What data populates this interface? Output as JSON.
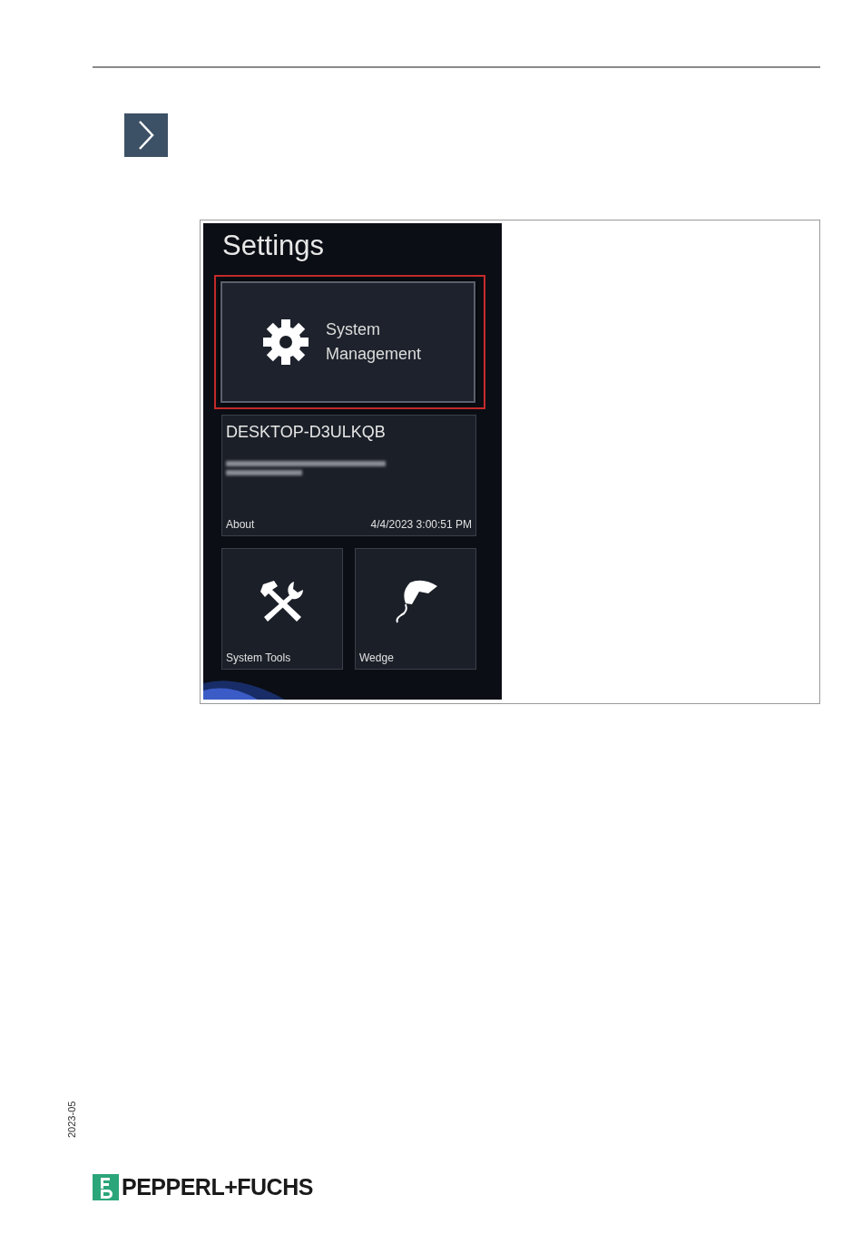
{
  "screenshot": {
    "title": "Settings",
    "tiles": [
      {
        "kind": "gear",
        "label": "System Management",
        "highlighted": true
      },
      {
        "kind": "info",
        "device_name": "DESKTOP-D3ULKQB",
        "label": "About",
        "timestamp": "4/4/2023 3:00:51 PM",
        "highlighted": false
      },
      {
        "kind": "tools",
        "label": "System Tools",
        "highlighted": false
      },
      {
        "kind": "scanner",
        "label": "Wedge",
        "highlighted": false
      }
    ]
  },
  "footer": {
    "date_code": "2023-05",
    "brand": "PEPPERL+FUCHS"
  }
}
